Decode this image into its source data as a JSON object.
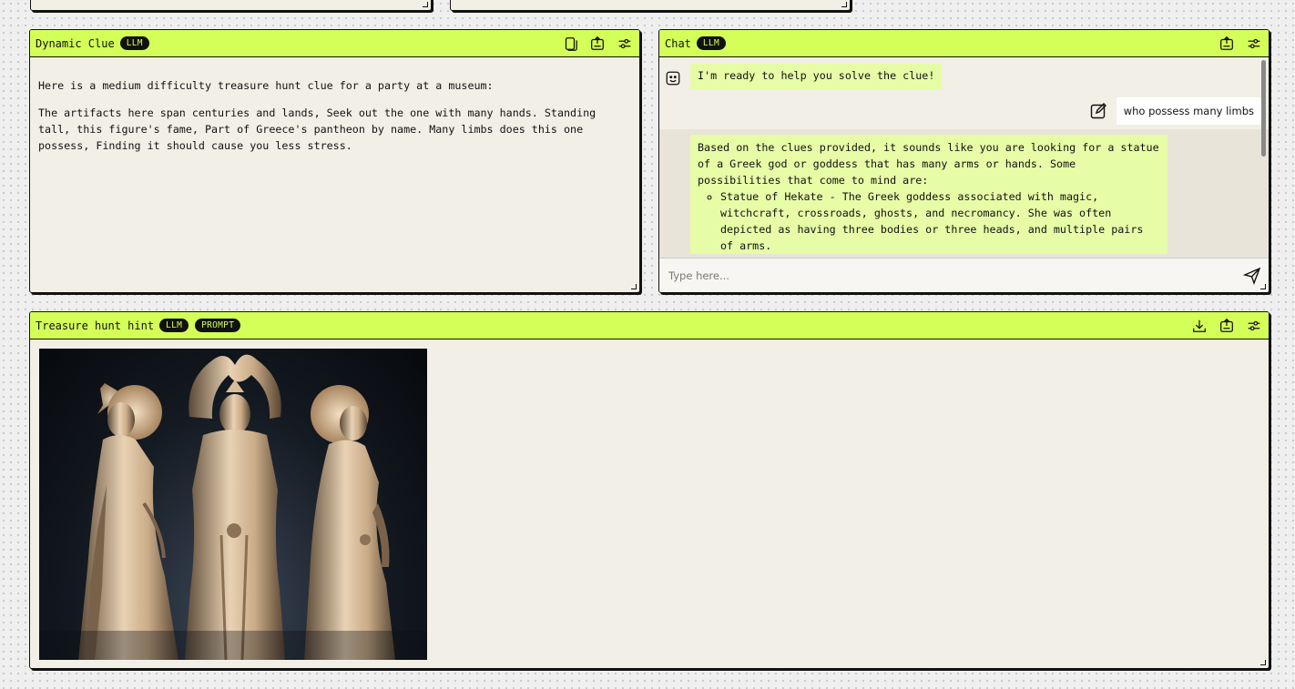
{
  "panels": {
    "clue": {
      "title": "Dynamic Clue",
      "badge": "LLM",
      "paragraphs": [
        "Here is a medium difficulty treasure hunt clue for a party at a museum:",
        "The artifacts here span centuries and lands, Seek out the one with many hands. Standing tall, this figure's fame, Part of Greece's pantheon by name. Many limbs does this one possess, Finding it should cause you less stress."
      ],
      "icons": [
        "copy-icon",
        "export-icon",
        "settings-sliders-icon"
      ]
    },
    "chat": {
      "title": "Chat",
      "badge": "LLM",
      "icons": [
        "export-icon",
        "settings-sliders-icon"
      ],
      "messages": {
        "bot_greeting": "I'm ready to help you solve the clue!",
        "user_message": "who possess many limbs",
        "bot_answer_intro": "Based on the clues provided, it sounds like you are looking for a statue of a Greek god or goddess that has many arms or hands. Some possibilities that come to mind are:",
        "bot_answer_item_1": "Statue of Hekate - The Greek goddess associated with magic, witchcraft, crossroads, ghosts, and necromancy. She was often depicted as having three bodies or three heads, and multiple pairs of arms."
      },
      "input_placeholder": "Type here...",
      "send_icon": "send-icon"
    },
    "hint": {
      "title": "Treasure hunt hint",
      "badges": [
        "LLM",
        "PROMPT"
      ],
      "icons": [
        "download-icon",
        "export-icon",
        "settings-sliders-icon"
      ],
      "image_icon": "statue-image"
    }
  },
  "colors": {
    "header_green": "#d4ff58",
    "panel_bg": "#f1efe6",
    "bubble_green": "#e6fca7",
    "border": "#111111"
  }
}
